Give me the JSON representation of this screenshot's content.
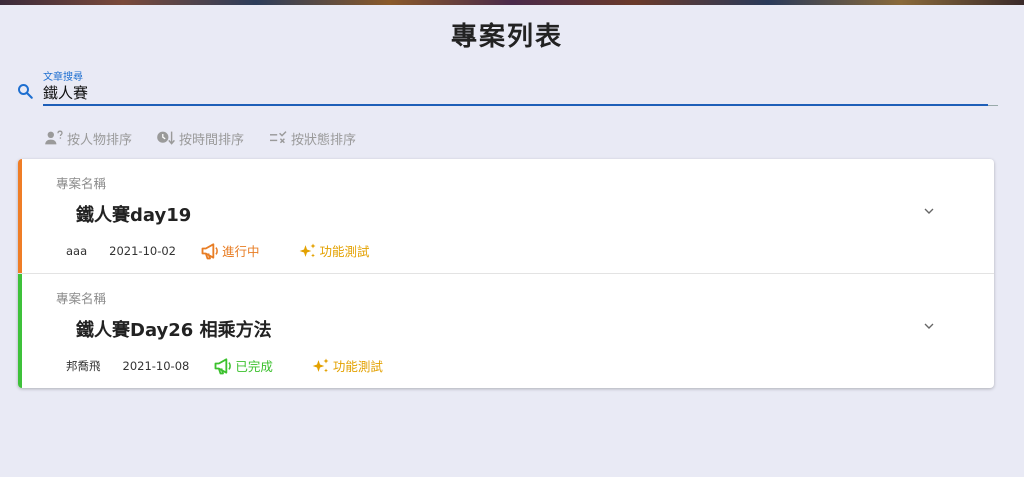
{
  "page": {
    "title": "專案列表"
  },
  "search": {
    "label": "文章搜尋",
    "value": "鐵人賽",
    "icon": "search-icon",
    "accent": "#1e6fd0"
  },
  "sort": [
    {
      "label": "按人物排序",
      "icon": "person-question-icon"
    },
    {
      "label": "按時間排序",
      "icon": "clock-arrow-down-icon"
    },
    {
      "label": "按狀態排序",
      "icon": "checklist-x-icon"
    }
  ],
  "projects": [
    {
      "caption": "專案名稱",
      "name": "鐵人賽day19",
      "owner": "aaa",
      "date": "2021-10-02",
      "status": "進行中",
      "status_color": "#e87d24",
      "tag": "功能測試",
      "tag_color": "#e3a100",
      "bar_color": "#ef7d26"
    },
    {
      "caption": "專案名稱",
      "name": "鐵人賽Day26 相乘方法",
      "owner": "邦喬飛",
      "date": "2021-10-08",
      "status": "已完成",
      "status_color": "#3cc12e",
      "tag": "功能測試",
      "tag_color": "#e3a100",
      "bar_color": "#3ec13a"
    }
  ]
}
